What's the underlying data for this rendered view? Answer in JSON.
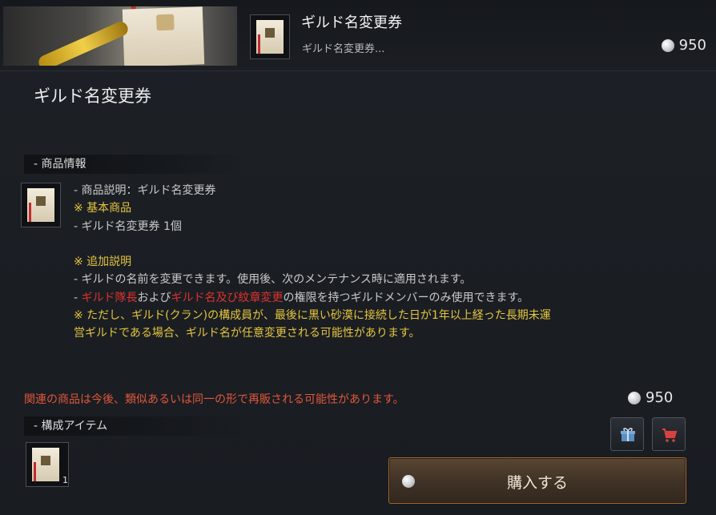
{
  "header": {
    "title": "ギルド名変更券",
    "subtitle": "ギルド名変更券...",
    "price": "950"
  },
  "main": {
    "title": "ギルド名変更券"
  },
  "product_info": {
    "section_label": "- 商品情報",
    "lines": [
      {
        "segments": [
          {
            "text": "- 商品説明：ギルド名変更券",
            "color": "white"
          }
        ]
      },
      {
        "segments": [
          {
            "text": "※ 基本商品",
            "color": "yellow"
          }
        ]
      },
      {
        "segments": [
          {
            "text": "- ギルド名変更券 1個",
            "color": "white"
          }
        ]
      },
      {
        "segments": [
          {
            "text": "",
            "color": "white"
          }
        ]
      },
      {
        "segments": [
          {
            "text": "※ 追加説明",
            "color": "yellow"
          }
        ]
      },
      {
        "segments": [
          {
            "text": "- ギルドの名前を変更できます。使用後、次のメンテナンス時に適用されます。",
            "color": "white"
          }
        ]
      },
      {
        "segments": [
          {
            "text": "- ",
            "color": "white"
          },
          {
            "text": "ギルド隊長",
            "color": "red"
          },
          {
            "text": "および",
            "color": "white"
          },
          {
            "text": "ギルド名及び紋章変更",
            "color": "red"
          },
          {
            "text": "の権限を持つギルドメンバーのみ使用できます。",
            "color": "white"
          }
        ]
      },
      {
        "segments": [
          {
            "text": "※ ただし、ギルド(クラン)の構成員が、最後に黒い砂漠に接続した日が1年以上経った長期未運",
            "color": "yellow"
          }
        ]
      },
      {
        "segments": [
          {
            "text": "営ギルドである場合、ギルド名が任意変更される可能性があります。",
            "color": "yellow"
          }
        ]
      }
    ]
  },
  "notice": "関連の商品は今後、類似あるいは同一の形で再販される可能性があります。",
  "price_bottom": "950",
  "components": {
    "section_label": "- 構成アイテム",
    "item_quantity": "1"
  },
  "buttons": {
    "buy_label": "購入する",
    "gift_icon": "gift-icon",
    "cart_icon": "cart-icon"
  },
  "colors": {
    "white": "#c9c9c9",
    "yellow": "#e5c53e",
    "red": "#e0312d",
    "notice": "#e0573c",
    "buy_border": "#a06a2e"
  }
}
